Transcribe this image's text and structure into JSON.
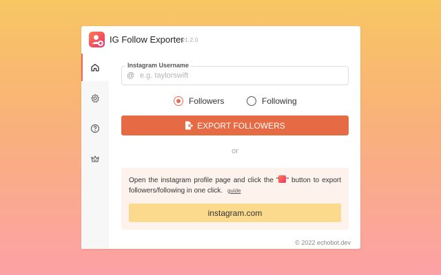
{
  "app": {
    "title": "IG Follow Exporter",
    "version": "v1.2.0"
  },
  "sidebar": {
    "items": [
      {
        "icon": "home-icon",
        "active": true
      },
      {
        "icon": "gear-icon",
        "active": false
      },
      {
        "icon": "help-icon",
        "active": false
      },
      {
        "icon": "crown-icon",
        "active": false
      }
    ]
  },
  "username": {
    "label": "Instagram Username",
    "prefix": "@",
    "placeholder": "e.g. taylorswift",
    "value": ""
  },
  "mode": {
    "options": [
      "Followers",
      "Following"
    ],
    "selected": "Followers"
  },
  "export_button": {
    "label": "EXPORT FOLLOWERS",
    "icon": "export-file-icon"
  },
  "or_text": "or",
  "info": {
    "text_before_icon": "Open the instagram profile page and click the \"",
    "text_after_icon": "\" button to export followers/following in one click.",
    "guide_label": "guide",
    "instagram_button": "instagram.com"
  },
  "footer": "© 2022 echobot.dev",
  "colors": {
    "accent": "#e66b44",
    "yellow_button": "#fbda8e",
    "info_background": "#fdf2ec"
  }
}
